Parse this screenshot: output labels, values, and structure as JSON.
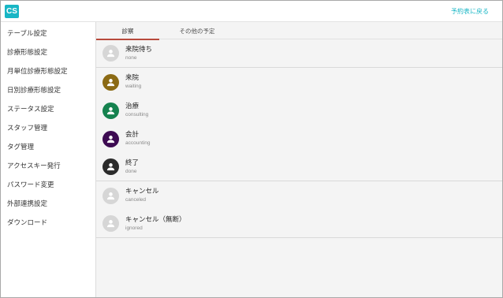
{
  "header": {
    "logo": "CS",
    "back_link": "予約表に戻る"
  },
  "sidebar": {
    "items": [
      {
        "label": "テーブル設定"
      },
      {
        "label": "診療形態設定"
      },
      {
        "label": "月単位診療形態設定"
      },
      {
        "label": "日別診療形態設定"
      },
      {
        "label": "ステータス設定"
      },
      {
        "label": "スタッフ管理"
      },
      {
        "label": "タグ管理"
      },
      {
        "label": "アクセスキー発行"
      },
      {
        "label": "パスワード変更"
      },
      {
        "label": "外部連携設定"
      },
      {
        "label": "ダウンロード"
      }
    ]
  },
  "tabs": [
    {
      "label": "診察",
      "active": true
    },
    {
      "label": "その他の予定",
      "active": false
    }
  ],
  "statuses": [
    {
      "name": "来院待ち",
      "code": "none",
      "color": "#d6d6d6"
    },
    {
      "name": "来院",
      "code": "waiting",
      "color": "#8b6a14"
    },
    {
      "name": "治療",
      "code": "consulting",
      "color": "#15824f"
    },
    {
      "name": "会計",
      "code": "accounting",
      "color": "#3d0b52"
    },
    {
      "name": "終了",
      "code": "done",
      "color": "#2b2b2b"
    },
    {
      "name": "キャンセル",
      "code": "canceled",
      "color": "#d6d6d6"
    },
    {
      "name": "キャンセル（無断）",
      "code": "ignored",
      "color": "#d6d6d6"
    }
  ]
}
